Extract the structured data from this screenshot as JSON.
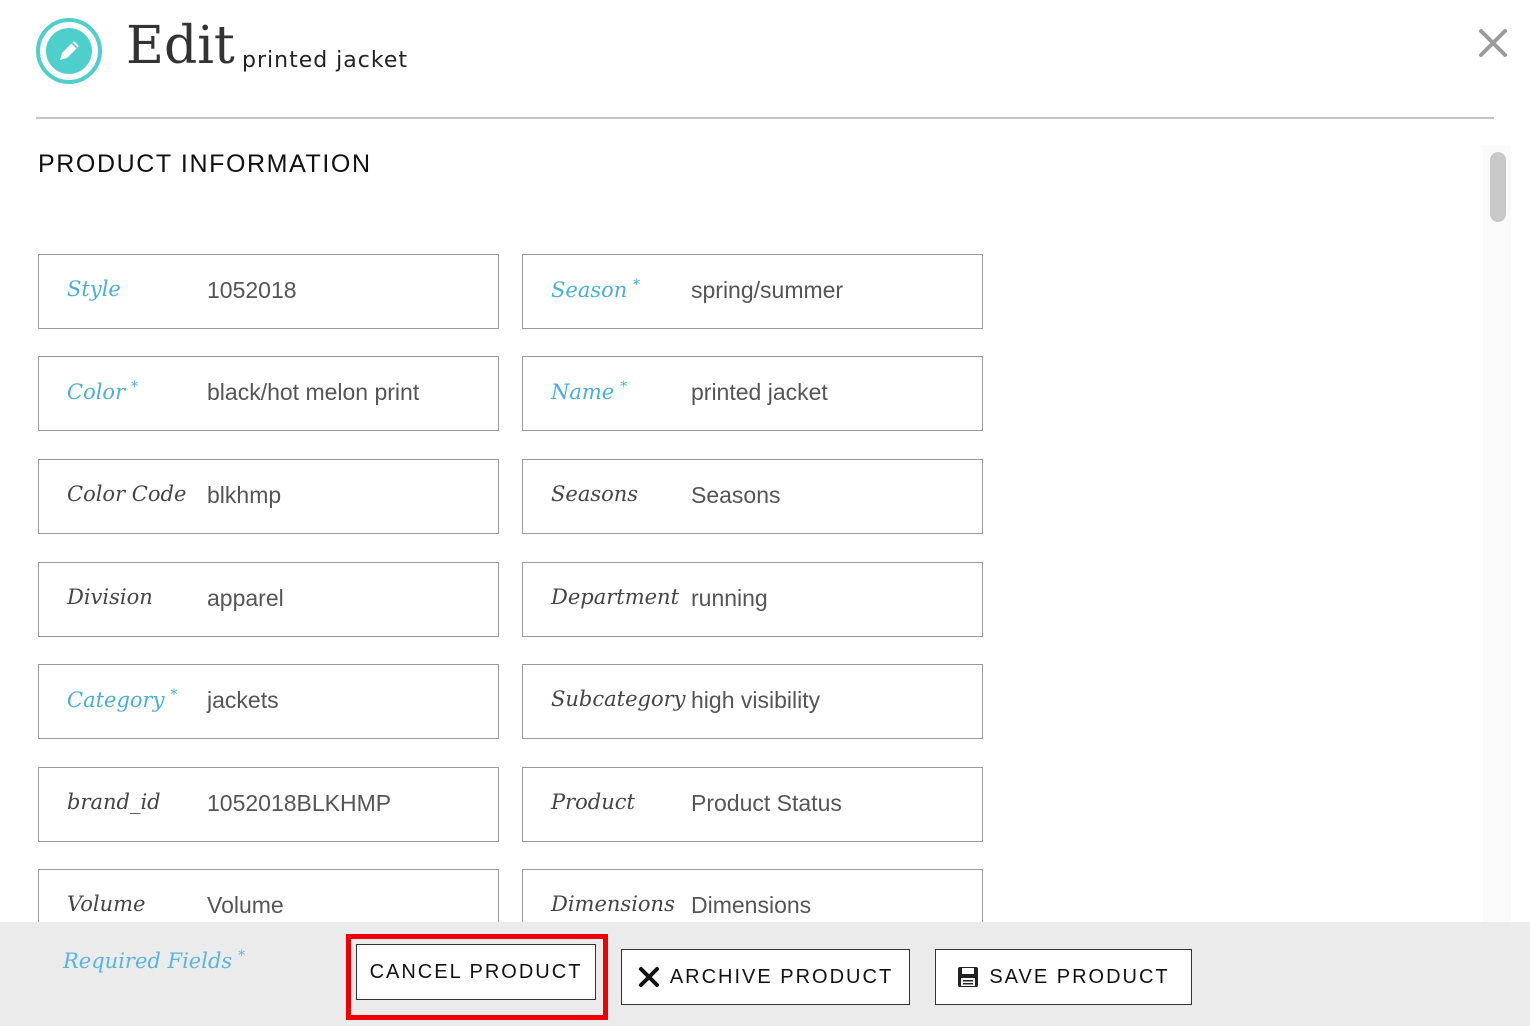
{
  "header": {
    "title": "Edit",
    "subtitle": "printed jacket"
  },
  "section_title": "PRODUCT INFORMATION",
  "colors": {
    "accent_teal": "#4ecfcb",
    "required_blue": "#4aaed6",
    "highlight_red": "#ee0000"
  },
  "fields": [
    {
      "label": "Style",
      "required": false,
      "value": "1052018",
      "label_color": "blue"
    },
    {
      "label": "Season",
      "required": true,
      "value": "spring/summer"
    },
    {
      "label": "Color",
      "required": true,
      "value": "black/hot melon print"
    },
    {
      "label": "Name",
      "required": true,
      "value": "printed jacket"
    },
    {
      "label": "Color Code",
      "required": false,
      "value": "blkhmp"
    },
    {
      "label": "Seasons",
      "required": false,
      "value": "Seasons"
    },
    {
      "label": "Division",
      "required": false,
      "value": "apparel"
    },
    {
      "label": "Department",
      "required": false,
      "value": "running"
    },
    {
      "label": "Category",
      "required": true,
      "value": "jackets"
    },
    {
      "label": "Subcategory",
      "required": false,
      "value": "high visibility"
    },
    {
      "label": "brand_id",
      "required": false,
      "value": "1052018BLKHMP"
    },
    {
      "label": "Product",
      "required": false,
      "value": "Product Status"
    },
    {
      "label": "Volume",
      "required": false,
      "value": "Volume"
    },
    {
      "label": "Dimensions",
      "required": false,
      "value": "Dimensions"
    }
  ],
  "footer": {
    "required_note": "Required Fields",
    "star": "*",
    "cancel_label": "CANCEL PRODUCT",
    "archive_label": "ARCHIVE PRODUCT",
    "save_label": "SAVE PRODUCT"
  },
  "icons": [
    "pencil-icon",
    "close-icon",
    "x-icon",
    "floppy-disk-icon"
  ]
}
